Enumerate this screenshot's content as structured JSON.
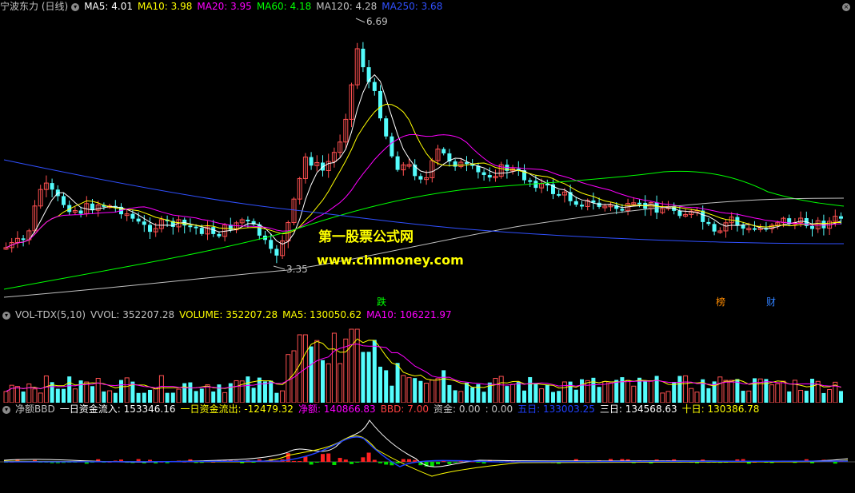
{
  "main": {
    "stock_name": "宁波东力 (日线)",
    "ma5": "MA5: 4.01",
    "ma10": "MA10: 3.98",
    "ma20": "MA20: 3.95",
    "ma60": "MA60: 4.18",
    "ma120": "MA120: 4.28",
    "ma250": "MA250: 3.68",
    "high_label": "6.69",
    "low_label": "3.35",
    "event_1": "跌",
    "event_2": "榜",
    "event_3": "财",
    "colors": {
      "ma5": "#ffffff",
      "ma10": "#ffff00",
      "ma20": "#ff00ff",
      "ma60": "#00ff00",
      "ma120": "#c0c0c0",
      "ma250": "#3050ff",
      "up": "#ff5050",
      "down": "#54fcfc"
    }
  },
  "watermark": {
    "line1": "第一股票公式网",
    "line2": "www.chnmoney.com"
  },
  "volume": {
    "title": "VOL-TDX(5,10)",
    "vvol": "VVOL: 352207.28",
    "volume": "VOLUME: 352207.28",
    "ma5": "MA5: 130050.62",
    "ma10": "MA10: 106221.97"
  },
  "flow": {
    "title": "净额BBD",
    "inflow": "一日资金流入: 153346.16",
    "outflow": "一日资金流出: -12479.32",
    "net": "净额: 140866.83",
    "bbd": "BBD: 7.00",
    "fund": "资金: 0.00",
    "fund2": ": 0.00",
    "day5": "五日: 133003.25",
    "day3": "三日: 134568.63",
    "day10": "十日: 130386.78"
  },
  "chart_data": {
    "type": "candlestick",
    "title": "宁波东力 (日线)",
    "price_high_marked": 6.69,
    "price_low_marked": 3.35,
    "x": [],
    "series": [
      {
        "name": "MA5",
        "last": 4.01
      },
      {
        "name": "MA10",
        "last": 3.98
      },
      {
        "name": "MA20",
        "last": 3.95
      },
      {
        "name": "MA60",
        "last": 4.18
      },
      {
        "name": "MA120",
        "last": 4.28
      },
      {
        "name": "MA250",
        "last": 3.68
      }
    ]
  }
}
